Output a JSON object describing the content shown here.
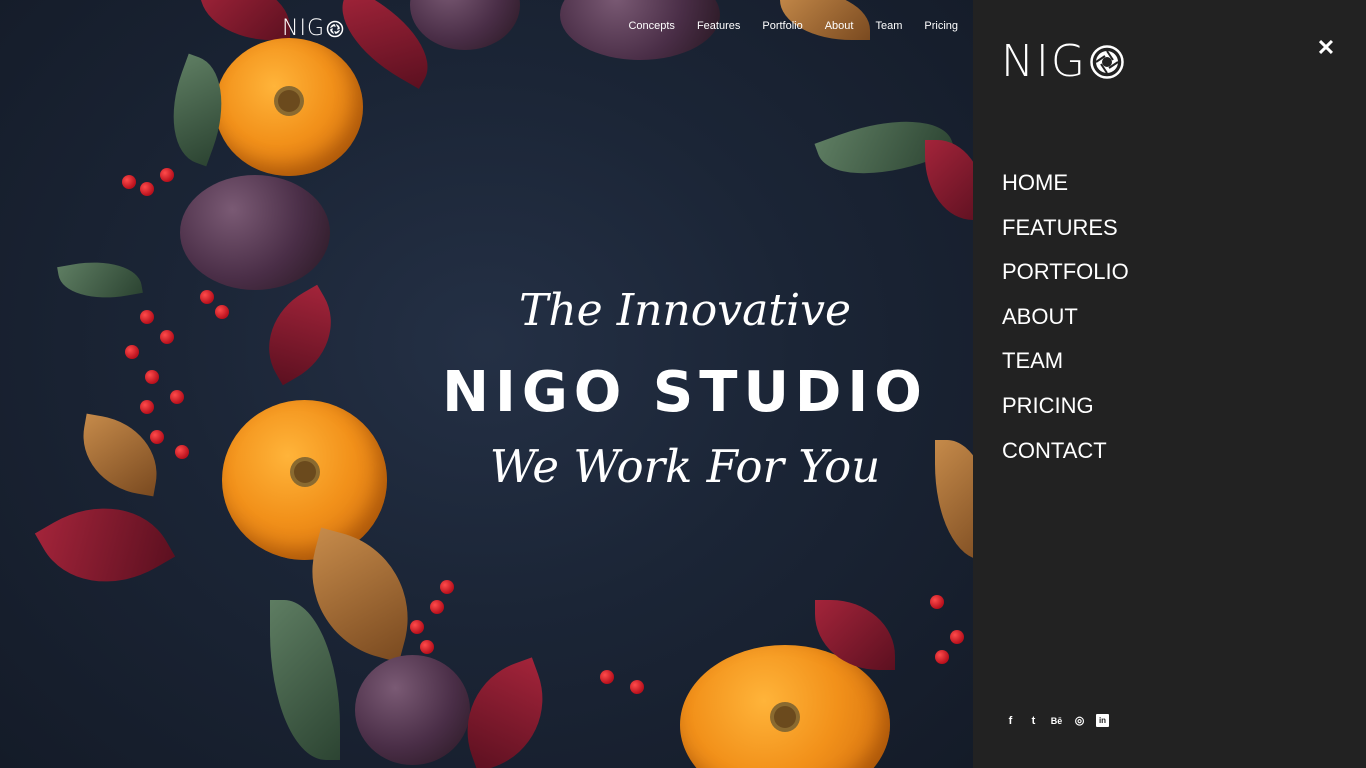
{
  "brand": {
    "name": "NIG"
  },
  "topnav": {
    "links": [
      "Concepts",
      "Features",
      "Portfolio",
      "About",
      "Team",
      "Pricing"
    ]
  },
  "hero": {
    "line1": "The Innovative",
    "line2": "NIGO STUDIO",
    "line3": "We Work For You"
  },
  "panel": {
    "close_label": "✕",
    "menu": [
      "HOME",
      "FEATURES",
      "PORTFOLIO",
      "ABOUT",
      "TEAM",
      "PRICING",
      "CONTACT"
    ],
    "socials": [
      {
        "icon": "facebook-icon",
        "glyph": "f"
      },
      {
        "icon": "twitter-icon",
        "glyph": "t"
      },
      {
        "icon": "behance-icon",
        "glyph": "Bē"
      },
      {
        "icon": "dribbble-icon",
        "glyph": "◎"
      },
      {
        "icon": "linkedin-icon",
        "glyph": "in"
      }
    ]
  },
  "colors": {
    "panel_bg": "#222222",
    "hero_bg": "#1b2536",
    "accent": "#f2911a"
  }
}
